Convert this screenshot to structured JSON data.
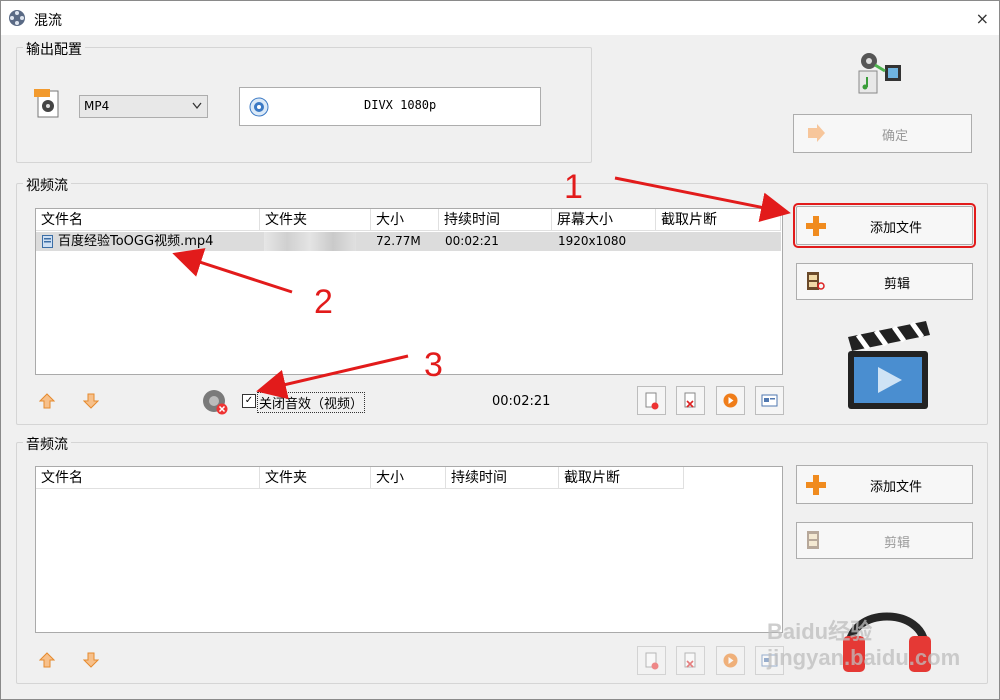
{
  "window": {
    "title": "混流",
    "close_glyph": "×",
    "app_icon": "film-reel-icon"
  },
  "output_config": {
    "label": "输出配置",
    "format_selected": "MP4",
    "profile": "DIVX 1080p",
    "ok_label": "确定"
  },
  "video_stream": {
    "label": "视频流",
    "columns": [
      "文件名",
      "文件夹",
      "大小",
      "持续时间",
      "屏幕大小",
      "截取片断"
    ],
    "rows": [
      {
        "name": "百度经验ToOGG视频.mp4",
        "folder": "",
        "size": "72.77M",
        "duration": "00:02:21",
        "screen": "1920x1080",
        "clip": ""
      }
    ],
    "add_file_label": "添加文件",
    "edit_label": "剪辑",
    "mute_label": "关闭音效（视频）",
    "mute_checked": true,
    "total_duration": "00:02:21"
  },
  "audio_stream": {
    "label": "音频流",
    "columns": [
      "文件名",
      "文件夹",
      "大小",
      "持续时间",
      "截取片断"
    ],
    "rows": [],
    "add_file_label": "添加文件",
    "edit_label": "剪辑"
  },
  "annotations": {
    "n1": "1",
    "n2": "2",
    "n3": "3",
    "color": "#e21b1b"
  },
  "watermark": "Baidu经验 jingyan.baidu.com"
}
